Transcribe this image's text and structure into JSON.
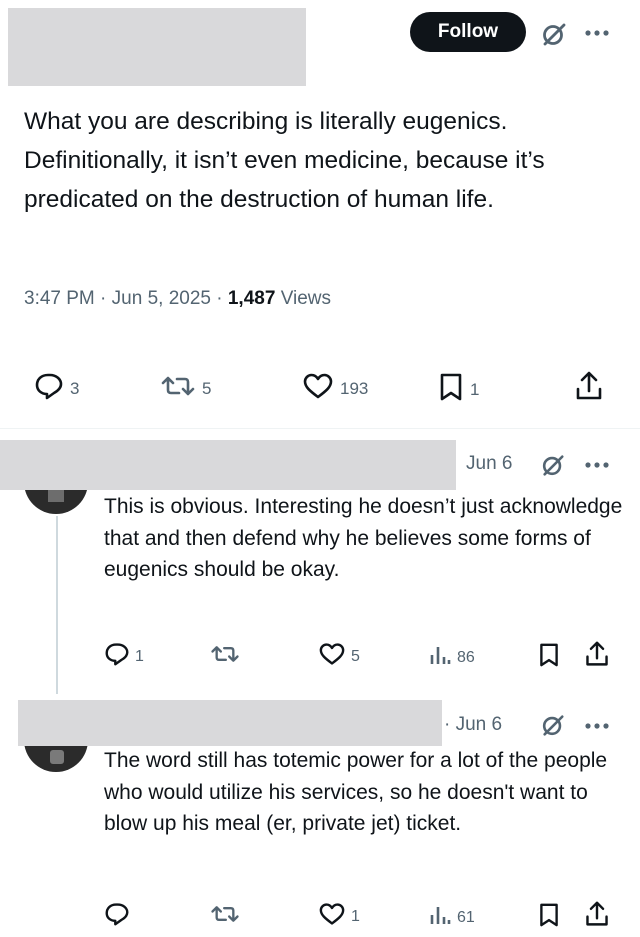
{
  "header": {
    "follow_label": "Follow"
  },
  "tweet": {
    "text": "What you are describing is literally eugenics. Definitionally, it isn’t even medicine, because it’s predicated on the destruction of human life.",
    "time": "3:47 PM",
    "date": "Jun 5, 2025",
    "views_count": "1,487",
    "views_label": "Views",
    "stats": {
      "replies": "3",
      "reposts": "5",
      "likes": "193",
      "bookmarks": "1"
    }
  },
  "replies": [
    {
      "date": "Jun 6",
      "text": "This is obvious. Interesting he doesn’t just acknowledge that and then defend why he believes some forms of eugenics should be okay.",
      "stats": {
        "replies": "1",
        "reposts": "",
        "likes": "5",
        "views": "86"
      }
    },
    {
      "date": "· Jun 6",
      "text": "The word still has totemic power for a lot of the people who would utilize his services, so he doesn't want to blow up his meal (er, private jet) ticket.",
      "stats": {
        "replies": "",
        "reposts": "",
        "likes": "1",
        "views": "61"
      }
    }
  ],
  "icons": {
    "grok": "grok-icon",
    "more": "more-icon",
    "reply": "reply-icon",
    "repost": "repost-icon",
    "like": "like-icon",
    "bookmark": "bookmark-icon",
    "share": "share-icon",
    "views": "views-icon"
  },
  "colors": {
    "text": "#0f1419",
    "muted": "#536471",
    "follow_bg": "#0f1419",
    "redaction": "#d9d9db"
  }
}
